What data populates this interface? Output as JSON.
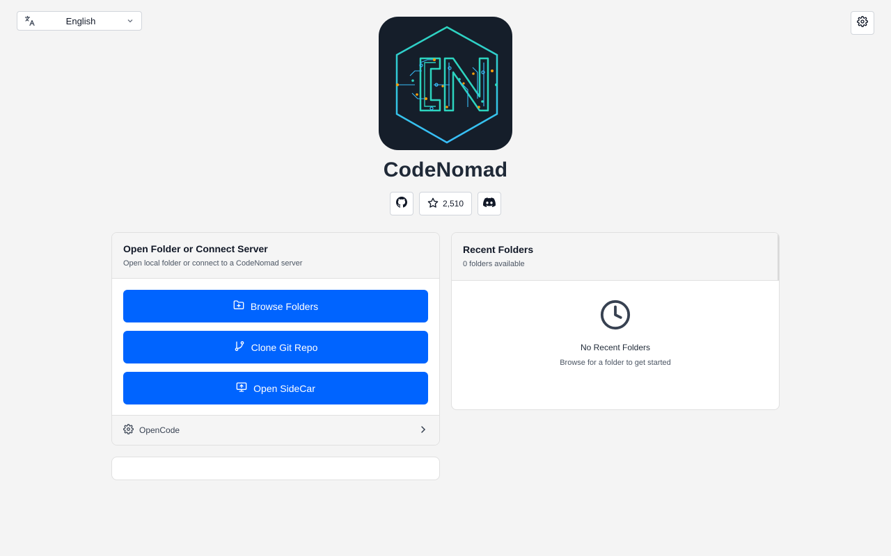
{
  "language": {
    "selected": "English"
  },
  "app": {
    "name": "CodeNomad",
    "logo_letters": "CN"
  },
  "links": {
    "github_stars": "2,510"
  },
  "open_card": {
    "title": "Open Folder or Connect Server",
    "subtitle": "Open local folder or connect to a CodeNomad server",
    "buttons": [
      {
        "label": "Browse Folders",
        "icon": "folder-plus-icon"
      },
      {
        "label": "Clone Git Repo",
        "icon": "git-branch-icon"
      },
      {
        "label": "Open SideCar",
        "icon": "monitor-upload-icon"
      }
    ],
    "footer_label": "OpenCode"
  },
  "recent_card": {
    "title": "Recent Folders",
    "count_text": "0 folders available",
    "empty_title": "No Recent Folders",
    "empty_subtitle": "Browse for a folder to get started"
  },
  "colors": {
    "primary": "#0064ff",
    "logo_bg": "#151e2a",
    "logo_teal": "#2dd4bf",
    "logo_blue": "#38bdf8",
    "logo_orange": "#f59e0b"
  }
}
